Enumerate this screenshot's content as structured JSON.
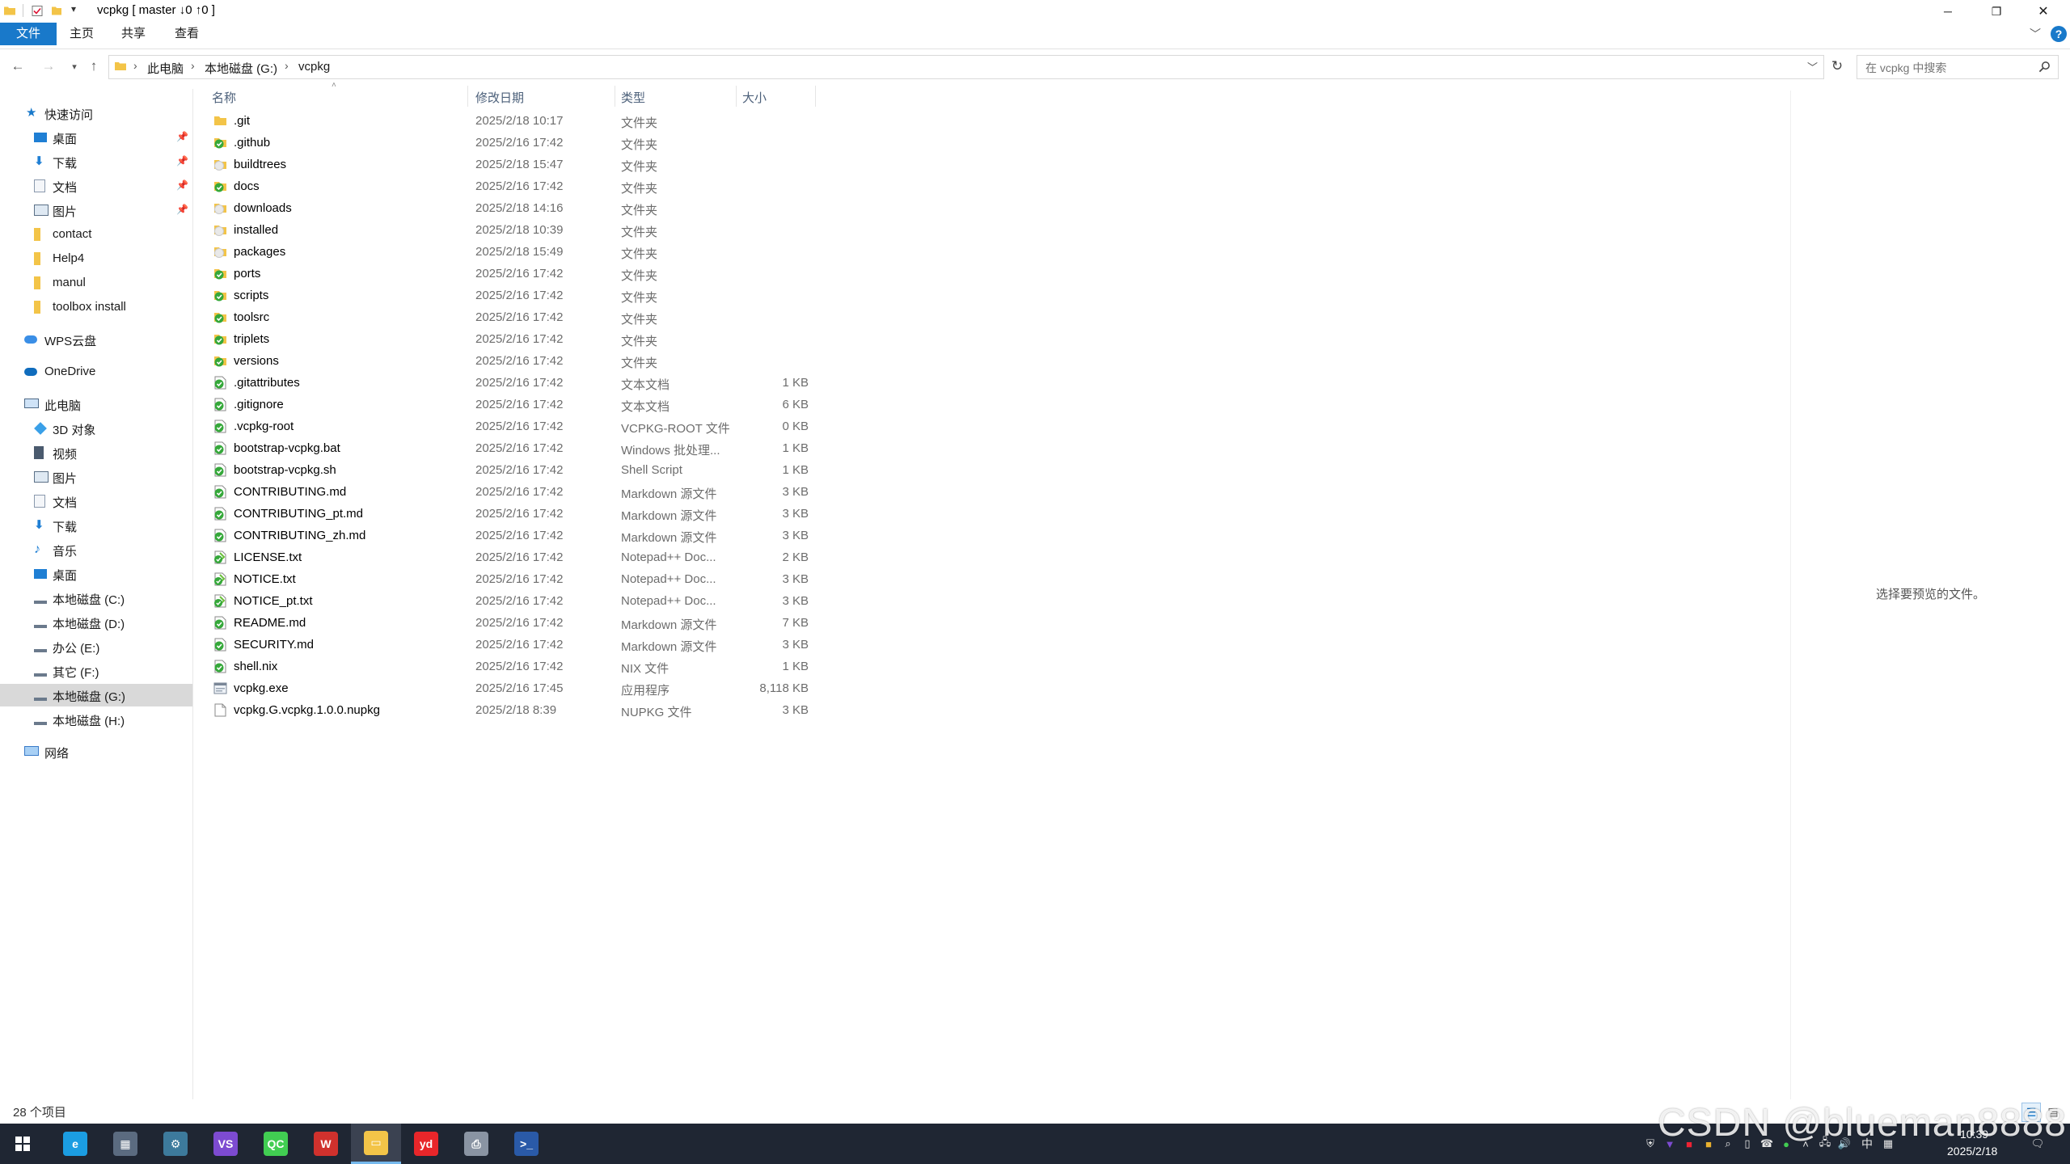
{
  "window": {
    "title": "vcpkg [ master ↓0 ↑0 ]",
    "controls": {
      "minimize": "─",
      "maximize": "❐",
      "close": "✕"
    }
  },
  "ribbon": {
    "tabs": [
      "文件",
      "主页",
      "共享",
      "查看"
    ]
  },
  "address": {
    "crumbs": [
      "此电脑",
      "本地磁盘 (G:)",
      "vcpkg"
    ],
    "search_placeholder": "在 vcpkg 中搜索"
  },
  "nav": {
    "quick_access": "快速访问",
    "quick_items": [
      "桌面",
      "下载",
      "文档",
      "图片",
      "contact",
      "Help4",
      "manul",
      "toolbox install"
    ],
    "wps": "WPS云盘",
    "onedrive": "OneDrive",
    "this_pc": "此电脑",
    "pc_items": [
      "3D 对象",
      "视频",
      "图片",
      "文档",
      "下载",
      "音乐",
      "桌面",
      "本地磁盘 (C:)",
      "本地磁盘 (D:)",
      "办公 (E:)",
      "其它 (F:)",
      "本地磁盘 (G:)",
      "本地磁盘 (H:)"
    ],
    "network": "网络"
  },
  "columns": {
    "name": "名称",
    "date": "修改日期",
    "type": "类型",
    "size": "大小"
  },
  "files": [
    {
      "name": ".git",
      "date": "2025/2/18 10:17",
      "type": "文件夹",
      "size": "",
      "icon": "folder"
    },
    {
      "name": ".github",
      "date": "2025/2/16 17:42",
      "type": "文件夹",
      "size": "",
      "icon": "git-ok"
    },
    {
      "name": "buildtrees",
      "date": "2025/2/18 15:47",
      "type": "文件夹",
      "size": "",
      "icon": "git-ignored"
    },
    {
      "name": "docs",
      "date": "2025/2/16 17:42",
      "type": "文件夹",
      "size": "",
      "icon": "git-ok"
    },
    {
      "name": "downloads",
      "date": "2025/2/18 14:16",
      "type": "文件夹",
      "size": "",
      "icon": "git-ignored"
    },
    {
      "name": "installed",
      "date": "2025/2/18 10:39",
      "type": "文件夹",
      "size": "",
      "icon": "git-ignored"
    },
    {
      "name": "packages",
      "date": "2025/2/18 15:49",
      "type": "文件夹",
      "size": "",
      "icon": "git-ignored"
    },
    {
      "name": "ports",
      "date": "2025/2/16 17:42",
      "type": "文件夹",
      "size": "",
      "icon": "git-ok"
    },
    {
      "name": "scripts",
      "date": "2025/2/16 17:42",
      "type": "文件夹",
      "size": "",
      "icon": "git-ok"
    },
    {
      "name": "toolsrc",
      "date": "2025/2/16 17:42",
      "type": "文件夹",
      "size": "",
      "icon": "git-ok"
    },
    {
      "name": "triplets",
      "date": "2025/2/16 17:42",
      "type": "文件夹",
      "size": "",
      "icon": "git-ok"
    },
    {
      "name": "versions",
      "date": "2025/2/16 17:42",
      "type": "文件夹",
      "size": "",
      "icon": "git-ok"
    },
    {
      "name": ".gitattributes",
      "date": "2025/2/16 17:42",
      "type": "文本文档",
      "size": "1 KB",
      "icon": "file-ok"
    },
    {
      "name": ".gitignore",
      "date": "2025/2/16 17:42",
      "type": "文本文档",
      "size": "6 KB",
      "icon": "file-ok"
    },
    {
      "name": ".vcpkg-root",
      "date": "2025/2/16 17:42",
      "type": "VCPKG-ROOT 文件",
      "size": "0 KB",
      "icon": "file-ok"
    },
    {
      "name": "bootstrap-vcpkg.bat",
      "date": "2025/2/16 17:42",
      "type": "Windows 批处理...",
      "size": "1 KB",
      "icon": "file-ok"
    },
    {
      "name": "bootstrap-vcpkg.sh",
      "date": "2025/2/16 17:42",
      "type": "Shell Script",
      "size": "1 KB",
      "icon": "file-ok"
    },
    {
      "name": "CONTRIBUTING.md",
      "date": "2025/2/16 17:42",
      "type": "Markdown 源文件",
      "size": "3 KB",
      "icon": "file-ok"
    },
    {
      "name": "CONTRIBUTING_pt.md",
      "date": "2025/2/16 17:42",
      "type": "Markdown 源文件",
      "size": "3 KB",
      "icon": "file-ok"
    },
    {
      "name": "CONTRIBUTING_zh.md",
      "date": "2025/2/16 17:42",
      "type": "Markdown 源文件",
      "size": "3 KB",
      "icon": "file-ok"
    },
    {
      "name": "LICENSE.txt",
      "date": "2025/2/16 17:42",
      "type": "Notepad++ Doc...",
      "size": "2 KB",
      "icon": "npp-ok"
    },
    {
      "name": "NOTICE.txt",
      "date": "2025/2/16 17:42",
      "type": "Notepad++ Doc...",
      "size": "3 KB",
      "icon": "npp-ok"
    },
    {
      "name": "NOTICE_pt.txt",
      "date": "2025/2/16 17:42",
      "type": "Notepad++ Doc...",
      "size": "3 KB",
      "icon": "npp-ok"
    },
    {
      "name": "README.md",
      "date": "2025/2/16 17:42",
      "type": "Markdown 源文件",
      "size": "7 KB",
      "icon": "file-ok"
    },
    {
      "name": "SECURITY.md",
      "date": "2025/2/16 17:42",
      "type": "Markdown 源文件",
      "size": "3 KB",
      "icon": "file-ok"
    },
    {
      "name": "shell.nix",
      "date": "2025/2/16 17:42",
      "type": "NIX 文件",
      "size": "1 KB",
      "icon": "file-ok"
    },
    {
      "name": "vcpkg.exe",
      "date": "2025/2/16 17:45",
      "type": "应用程序",
      "size": "8,118 KB",
      "icon": "exe"
    },
    {
      "name": "vcpkg.G.vcpkg.1.0.0.nupkg",
      "date": "2025/2/18 8:39",
      "type": "NUPKG 文件",
      "size": "3 KB",
      "icon": "file-plain"
    }
  ],
  "preview_text": "选择要预览的文件。",
  "status": {
    "count": "28 个项目"
  },
  "taskbar": {
    "apps": [
      {
        "name": "edge",
        "label": "e",
        "color": "#1b9de2"
      },
      {
        "name": "calculator",
        "label": "▦",
        "color": "#5b6b80"
      },
      {
        "name": "python-ide",
        "label": "⚙",
        "color": "#3d7a9c"
      },
      {
        "name": "visual-studio",
        "label": "VS",
        "color": "#7d4bd1"
      },
      {
        "name": "qt-creator",
        "label": "QC",
        "color": "#41cd52"
      },
      {
        "name": "wps",
        "label": "W",
        "color": "#d0312d"
      },
      {
        "name": "file-explorer",
        "label": "▭",
        "color": "#f3c448"
      },
      {
        "name": "youdao",
        "label": "yd",
        "color": "#e8262a"
      },
      {
        "name": "printer",
        "label": "⎙",
        "color": "#8a94a3"
      },
      {
        "name": "powershell",
        "label": ">_",
        "color": "#2a5aa8"
      }
    ],
    "time": "10:39",
    "date": "2025/2/18",
    "input_method": "中"
  },
  "watermark": "CSDN @blueman8888",
  "colors": {
    "accent": "#1979ca",
    "git_ok": "#35a83a",
    "git_ignored": "#c9c9c9",
    "folder": "#f3c448"
  }
}
